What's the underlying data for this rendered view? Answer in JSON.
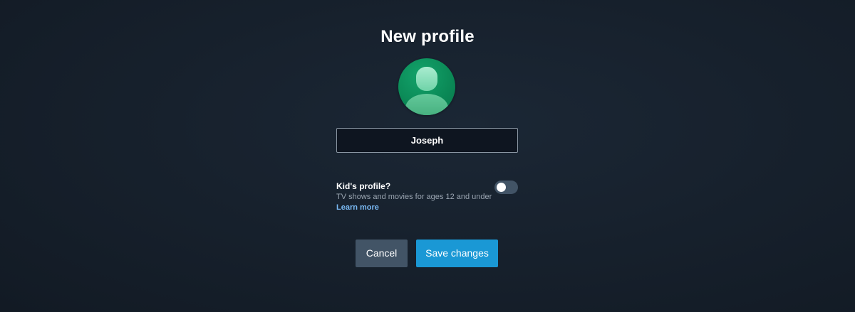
{
  "dialog": {
    "title": "New profile",
    "name_input": {
      "value": "Joseph",
      "placeholder": ""
    },
    "kids_profile": {
      "label": "Kid's profile?",
      "description": "TV shows and movies for ages 12 and under",
      "learn_more": "Learn more",
      "enabled": false
    },
    "buttons": {
      "cancel_label": "Cancel",
      "save_label": "Save changes"
    }
  },
  "icons": {
    "avatar": "user-silhouette-icon"
  },
  "colors": {
    "background": "#17212d",
    "avatar_green": "#0b8a57",
    "primary_button": "#1a98d5",
    "secondary_button": "#425466",
    "link": "#79b8f3",
    "toggle_track": "#425466"
  }
}
